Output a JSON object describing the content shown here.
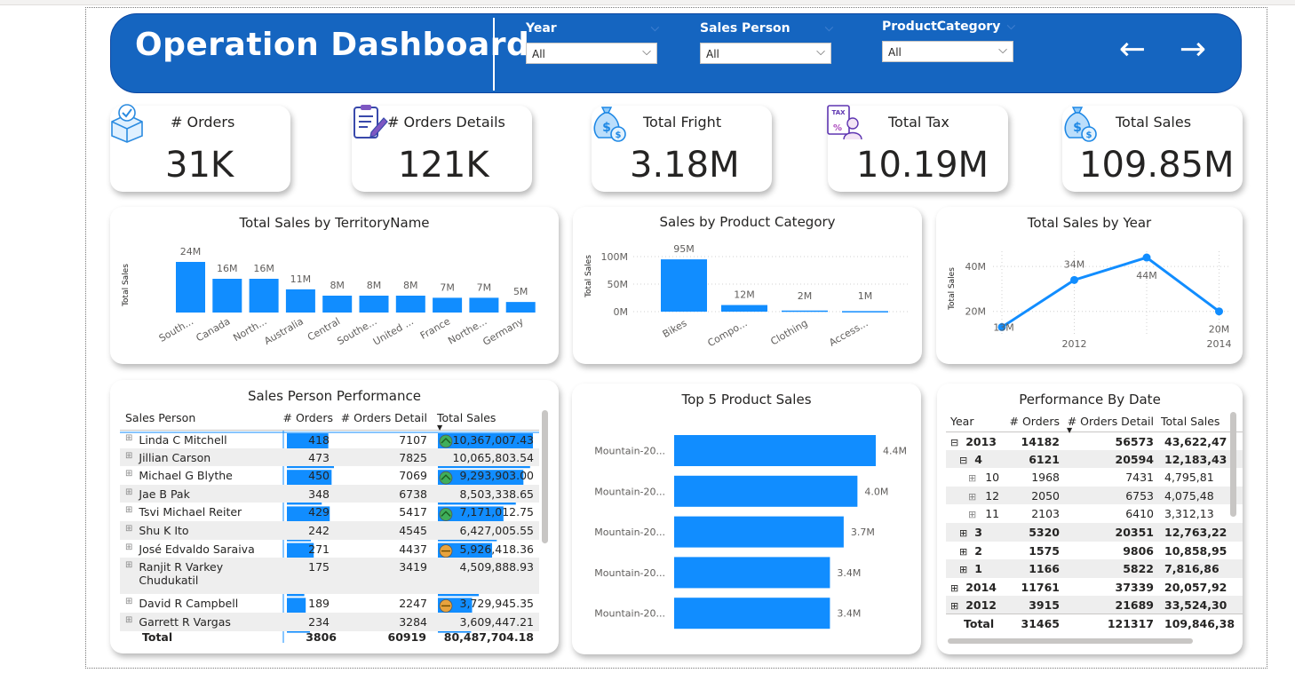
{
  "header": {
    "title": "Operation Dashboard",
    "slicers": [
      {
        "label": "Year",
        "value": "All"
      },
      {
        "label": "Sales Person",
        "value": "All"
      },
      {
        "label": "ProductCategory",
        "value": "All"
      }
    ],
    "nav_back": "←",
    "nav_forward": "→"
  },
  "colors": {
    "header": "#1565c0",
    "bar": "#118dff",
    "good": "#3fae5a",
    "mid": "#e8a33d"
  },
  "kpis": [
    {
      "title": "# Orders",
      "value": "31K",
      "icon": "box-check-icon"
    },
    {
      "title": "# Orders Details",
      "value": "121K",
      "icon": "clipboard-edit-icon"
    },
    {
      "title": "Total Fright",
      "value": "3.18M",
      "icon": "money-bag-icon"
    },
    {
      "title": "Total Tax",
      "value": "10.19M",
      "icon": "tax-document-icon"
    },
    {
      "title": "Total Sales",
      "value": "109.85M",
      "icon": "money-bag-icon"
    }
  ],
  "chart_data": [
    {
      "type": "bar",
      "title": "Total Sales by TerritoryName",
      "ylabel": "Total Sales",
      "xlabel": "",
      "categories": [
        "South...",
        "Canada",
        "North...",
        "Australia",
        "Central",
        "Southe...",
        "United ...",
        "France",
        "Northe...",
        "Germany"
      ],
      "values": [
        24,
        16,
        16,
        11,
        8,
        8,
        8,
        7,
        7,
        5
      ],
      "data_labels": [
        "24M",
        "16M",
        "16M",
        "11M",
        "8M",
        "8M",
        "8M",
        "7M",
        "7M",
        "5M"
      ],
      "ylim": [
        0,
        24
      ]
    },
    {
      "type": "bar",
      "title": "Sales by Product Category",
      "ylabel": "Total Sales",
      "xlabel": "",
      "categories": [
        "Bikes",
        "Compo...",
        "Clothing",
        "Access..."
      ],
      "values": [
        95,
        12,
        2,
        1
      ],
      "data_labels": [
        "95M",
        "12M",
        "2M",
        "1M"
      ],
      "yticks": [
        "0M",
        "50M",
        "100M"
      ],
      "ylim": [
        0,
        100
      ]
    },
    {
      "type": "line",
      "title": "Total Sales by Year",
      "ylabel": "Total Sales",
      "xlabel": "",
      "x": [
        2011,
        2012,
        2013,
        2014
      ],
      "values": [
        13,
        34,
        44,
        20
      ],
      "data_labels": [
        "13M",
        "34M",
        "44M",
        "20M"
      ],
      "xticks": [
        "2012",
        "2014"
      ],
      "yticks": [
        "20M",
        "40M"
      ],
      "ylim": [
        10,
        46
      ]
    },
    {
      "type": "bar",
      "orientation": "horizontal",
      "title": "Top 5 Product Sales",
      "categories": [
        "Mountain-20...",
        "Mountain-20...",
        "Mountain-20...",
        "Mountain-20...",
        "Mountain-20..."
      ],
      "values": [
        4.4,
        4.0,
        3.7,
        3.4,
        3.4
      ],
      "data_labels": [
        "4.4M",
        "4.0M",
        "3.7M",
        "3.4M",
        "3.4M"
      ]
    }
  ],
  "sales_person_table": {
    "title": "Sales Person Performance",
    "columns": [
      "Sales Person",
      "# Orders",
      "# Orders Detail",
      "Total Sales"
    ],
    "rows": [
      {
        "name": "Linda C Mitchell",
        "orders": "418",
        "details": "7107",
        "sales": "10,367,007.43",
        "status": "good",
        "orders_frac": 0.88,
        "sales_frac": 1.0
      },
      {
        "name": "Jillian Carson",
        "orders": "473",
        "details": "7825",
        "sales": "10,065,803.54",
        "status": "good",
        "orders_frac": 1.0,
        "sales_frac": 0.97
      },
      {
        "name": "Michael G Blythe",
        "orders": "450",
        "details": "7069",
        "sales": "9,293,903.00",
        "status": "good",
        "orders_frac": 0.95,
        "sales_frac": 0.9
      },
      {
        "name": "Jae B Pak",
        "orders": "348",
        "details": "6738",
        "sales": "8,503,338.65",
        "status": "good",
        "orders_frac": 0.74,
        "sales_frac": 0.82
      },
      {
        "name": "Tsvi Michael Reiter",
        "orders": "429",
        "details": "5417",
        "sales": "7,171,012.75",
        "status": "good",
        "orders_frac": 0.91,
        "sales_frac": 0.69
      },
      {
        "name": "Shu K Ito",
        "orders": "242",
        "details": "4545",
        "sales": "6,427,005.55",
        "status": "mid",
        "orders_frac": 0.51,
        "sales_frac": 0.62
      },
      {
        "name": "José Edvaldo Saraiva",
        "orders": "271",
        "details": "4437",
        "sales": "5,926,418.36",
        "status": "mid",
        "orders_frac": 0.57,
        "sales_frac": 0.57
      },
      {
        "name": "Ranjit R Varkey Chudukatil",
        "orders": "175",
        "details": "3419",
        "sales": "4,509,888.93",
        "status": "mid",
        "orders_frac": 0.37,
        "sales_frac": 0.43
      },
      {
        "name": "David R Campbell",
        "orders": "189",
        "details": "2247",
        "sales": "3,729,945.35",
        "status": "mid",
        "orders_frac": 0.4,
        "sales_frac": 0.36
      },
      {
        "name": "Garrett R Vargas",
        "orders": "234",
        "details": "3284",
        "sales": "3,609,447.21",
        "status": "mid",
        "orders_frac": 0.49,
        "sales_frac": 0.35
      }
    ],
    "total": {
      "label": "Total",
      "orders": "3806",
      "details": "60919",
      "sales": "80,487,704.18"
    }
  },
  "date_table": {
    "title": "Performance By Date",
    "columns": [
      "Year",
      "# Orders",
      "# Orders Detail",
      "Total Sales"
    ],
    "rows": [
      {
        "label": "2013",
        "level": 0,
        "toggle": "⊟",
        "bold": true,
        "orders": "14182",
        "details": "56573",
        "sales": "43,622,47"
      },
      {
        "label": "4",
        "level": 1,
        "toggle": "⊟",
        "bold": true,
        "orders": "6121",
        "details": "20594",
        "sales": "12,183,43"
      },
      {
        "label": "10",
        "level": 2,
        "toggle": "⊞",
        "bold": false,
        "orders": "1968",
        "details": "7431",
        "sales": "4,795,81"
      },
      {
        "label": "12",
        "level": 2,
        "toggle": "⊞",
        "bold": false,
        "orders": "2050",
        "details": "6753",
        "sales": "4,075,48"
      },
      {
        "label": "11",
        "level": 2,
        "toggle": "⊞",
        "bold": false,
        "orders": "2103",
        "details": "6410",
        "sales": "3,312,13"
      },
      {
        "label": "3",
        "level": 1,
        "toggle": "⊞",
        "bold": true,
        "orders": "5320",
        "details": "20351",
        "sales": "12,763,22"
      },
      {
        "label": "2",
        "level": 1,
        "toggle": "⊞",
        "bold": true,
        "orders": "1575",
        "details": "9806",
        "sales": "10,858,95"
      },
      {
        "label": "1",
        "level": 1,
        "toggle": "⊞",
        "bold": true,
        "orders": "1166",
        "details": "5822",
        "sales": "7,816,86"
      },
      {
        "label": "2014",
        "level": 0,
        "toggle": "⊞",
        "bold": true,
        "orders": "11761",
        "details": "37339",
        "sales": "20,057,92"
      },
      {
        "label": "2012",
        "level": 0,
        "toggle": "⊞",
        "bold": true,
        "orders": "3915",
        "details": "21689",
        "sales": "33,524,30"
      }
    ],
    "total": {
      "label": "Total",
      "orders": "31465",
      "details": "121317",
      "sales": "109,846,38"
    }
  }
}
